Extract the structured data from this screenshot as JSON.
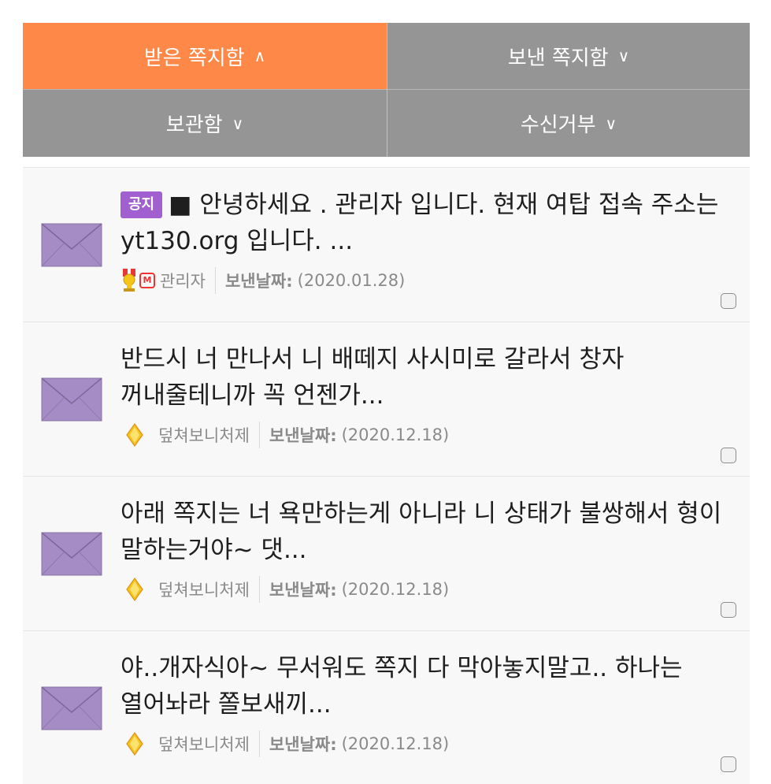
{
  "tabs": [
    {
      "label": "받은 쪽지함",
      "chevron": "∧",
      "active": true
    },
    {
      "label": "보낸 쪽지함",
      "chevron": "∨",
      "active": false
    },
    {
      "label": "보관함",
      "chevron": "∨",
      "active": false
    },
    {
      "label": "수신거부",
      "chevron": "∨",
      "active": false
    }
  ],
  "colors": {
    "active_tab": "#fe8847",
    "inactive_tab": "#959595",
    "notice_badge": "#a25fcf",
    "envelope": "#a68cc4"
  },
  "messages": [
    {
      "notice_badge": "공지",
      "title": "■ 안녕하세요 . 관리자 입니다. 현재 여탑 접속 주소는 yt130.org 입니다. ...",
      "sender": "관리자",
      "sender_icon": "admin-trophy-icon",
      "date_label": "보낸날짜:",
      "date": "(2020.01.28)"
    },
    {
      "title": "반드시 너 만나서 니 배떼지 사시미로 갈라서 창자 꺼내줄테니까 꼭 언젠가...",
      "sender": "덮쳐보니처제",
      "sender_icon": "yellow-diamond-icon",
      "date_label": "보낸날짜:",
      "date": "(2020.12.18)"
    },
    {
      "title": "아래 쪽지는 너 욕만하는게 아니라 니 상태가 불쌍해서 형이 말하는거야~ 댓...",
      "sender": "덮쳐보니처제",
      "sender_icon": "yellow-diamond-icon",
      "date_label": "보낸날짜:",
      "date": "(2020.12.18)"
    },
    {
      "title": "야..개자식아~ 무서워도 쪽지 다 막아놓지말고.. 하나는 열어놔라 쫄보새끼...",
      "sender": "덮쳐보니처제",
      "sender_icon": "yellow-diamond-icon",
      "date_label": "보낸날짜:",
      "date": "(2020.12.18)"
    }
  ]
}
